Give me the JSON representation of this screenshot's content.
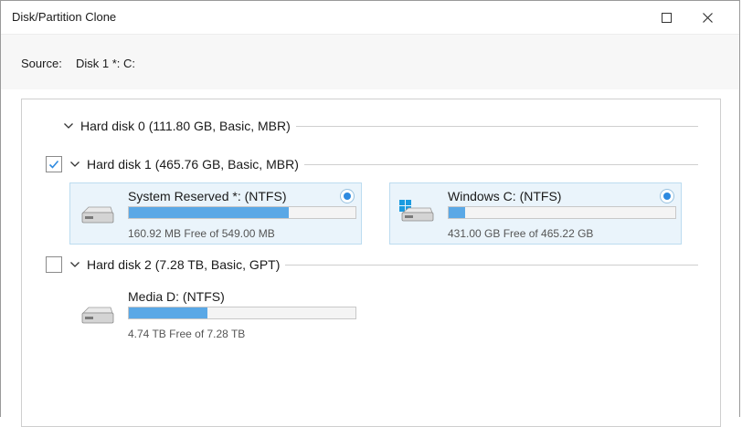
{
  "window": {
    "title": "Disk/Partition Clone"
  },
  "source": {
    "label": "Source:",
    "value": "Disk 1 *: C:"
  },
  "disks": [
    {
      "label": "Hard disk 0 (111.80 GB, Basic, MBR)",
      "has_checkbox": false,
      "checked": false,
      "partitions": []
    },
    {
      "label": "Hard disk 1 (465.76 GB, Basic, MBR)",
      "has_checkbox": true,
      "checked": true,
      "partitions": [
        {
          "name": "System Reserved *: (NTFS)",
          "free_text": "160.92 MB Free of 549.00 MB",
          "used_fraction": 0.71,
          "icon": "hard-drive-icon",
          "selected": true
        },
        {
          "name": "Windows C: (NTFS)",
          "free_text": "431.00 GB Free of 465.22 GB",
          "used_fraction": 0.07,
          "icon": "windows-drive-icon",
          "selected": true
        }
      ]
    },
    {
      "label": "Hard disk 2 (7.28 TB, Basic, GPT)",
      "has_checkbox": true,
      "checked": false,
      "partitions": [
        {
          "name": "Media D: (NTFS)",
          "free_text": "4.74 TB Free of 7.28 TB",
          "used_fraction": 0.35,
          "icon": "hard-drive-icon",
          "selected": false
        }
      ]
    }
  ],
  "colors": {
    "accent": "#2e8ae0",
    "bar_fill": "#5aa8e6",
    "card_selected_bg": "#eaf4fb",
    "checkmark": "#2e8ae0"
  }
}
